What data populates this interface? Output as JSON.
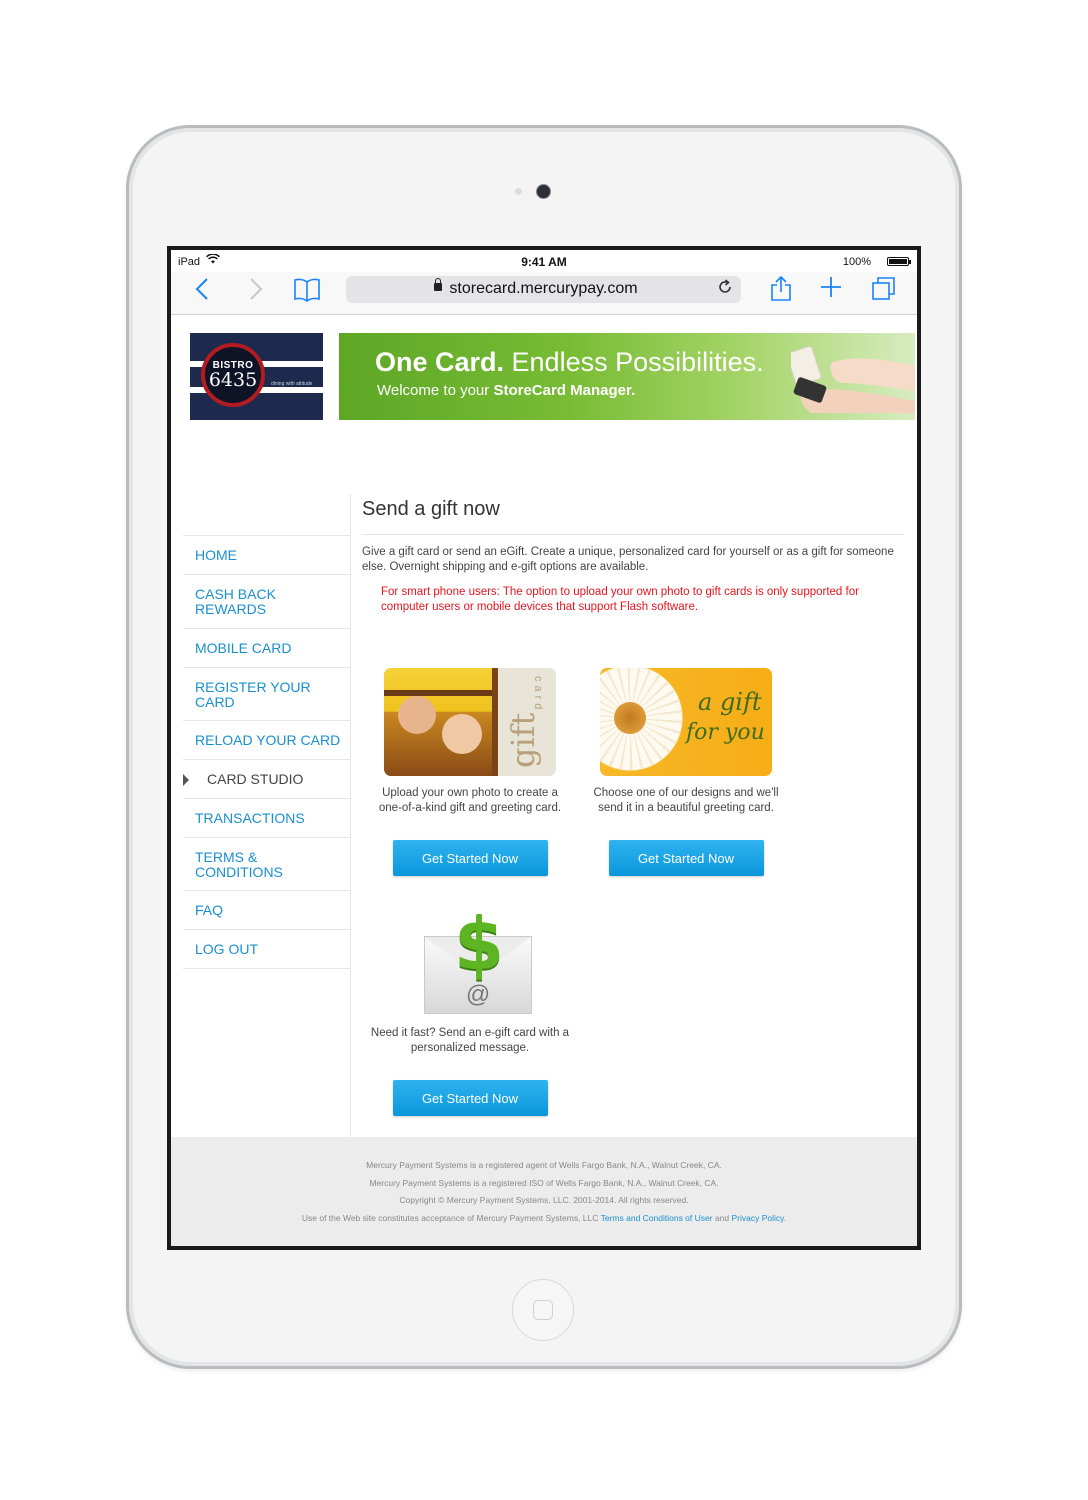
{
  "status_bar": {
    "carrier": "iPad",
    "time": "9:41 AM",
    "battery": "100%"
  },
  "browser": {
    "url": "storecard.mercurypay.com"
  },
  "logo": {
    "line1": "BISTRO",
    "line2": "6435",
    "tagline": "dining with attitude"
  },
  "banner": {
    "headline_bold": "One Card.",
    "headline_rest": " Endless Possibilities.",
    "subline_prefix": "Welcome to your ",
    "subline_bold": "StoreCard Manager."
  },
  "nav": {
    "items": [
      {
        "label": "HOME",
        "active": false
      },
      {
        "label": "CASH BACK REWARDS",
        "active": false
      },
      {
        "label": "MOBILE CARD",
        "active": false
      },
      {
        "label": "REGISTER YOUR CARD",
        "active": false
      },
      {
        "label": "RELOAD YOUR CARD",
        "active": false
      },
      {
        "label": "CARD STUDIO",
        "active": true
      },
      {
        "label": "TRANSACTIONS",
        "active": false
      },
      {
        "label": "TERMS & CONDITIONS",
        "active": false
      },
      {
        "label": "FAQ",
        "active": false
      },
      {
        "label": "LOG OUT",
        "active": false
      }
    ]
  },
  "main": {
    "title": "Send a gift now",
    "intro": "Give a gift card or send an eGift. Create a unique, personalized card for yourself or as a gift for someone else. Overnight shipping and e-gift options are available.",
    "warning": "For smart phone users: The option to upload your own photo to gift cards is only supported for computer users or mobile devices that support Flash software.",
    "cards": [
      {
        "desc": "Upload your own photo to create a one-of-a-kind gift and greeting card.",
        "button": "Get Started Now",
        "img_text": "gift",
        "img_subtext": "card"
      },
      {
        "desc": "Choose one of our designs and we'll send it in a beautiful greeting card.",
        "button": "Get Started Now",
        "img_line1": "a gift",
        "img_line2": "for you"
      },
      {
        "desc": "Need it fast? Send an e-gift card with a personalized message.",
        "button": "Get Started Now"
      }
    ]
  },
  "footer": {
    "line1": "Mercury Payment Systems is a registered agent of Wells Fargo Bank, N.A., Walnut Creek, CA.",
    "line2": "Mercury Payment Systems is a registered ISO of Wells Fargo Bank, N.A., Walnut Creek, CA.",
    "line3": "Copyright © Mercury Payment Systems, LLC. 2001-2014. All rights reserved.",
    "line4_prefix": "Use of the Web site constitutes acceptance of Mercury Payment Systems, LLC ",
    "terms_link": "Terms and Conditions of User",
    "line4_and": " and ",
    "privacy_link": "Privacy Policy",
    "line4_end": "."
  }
}
